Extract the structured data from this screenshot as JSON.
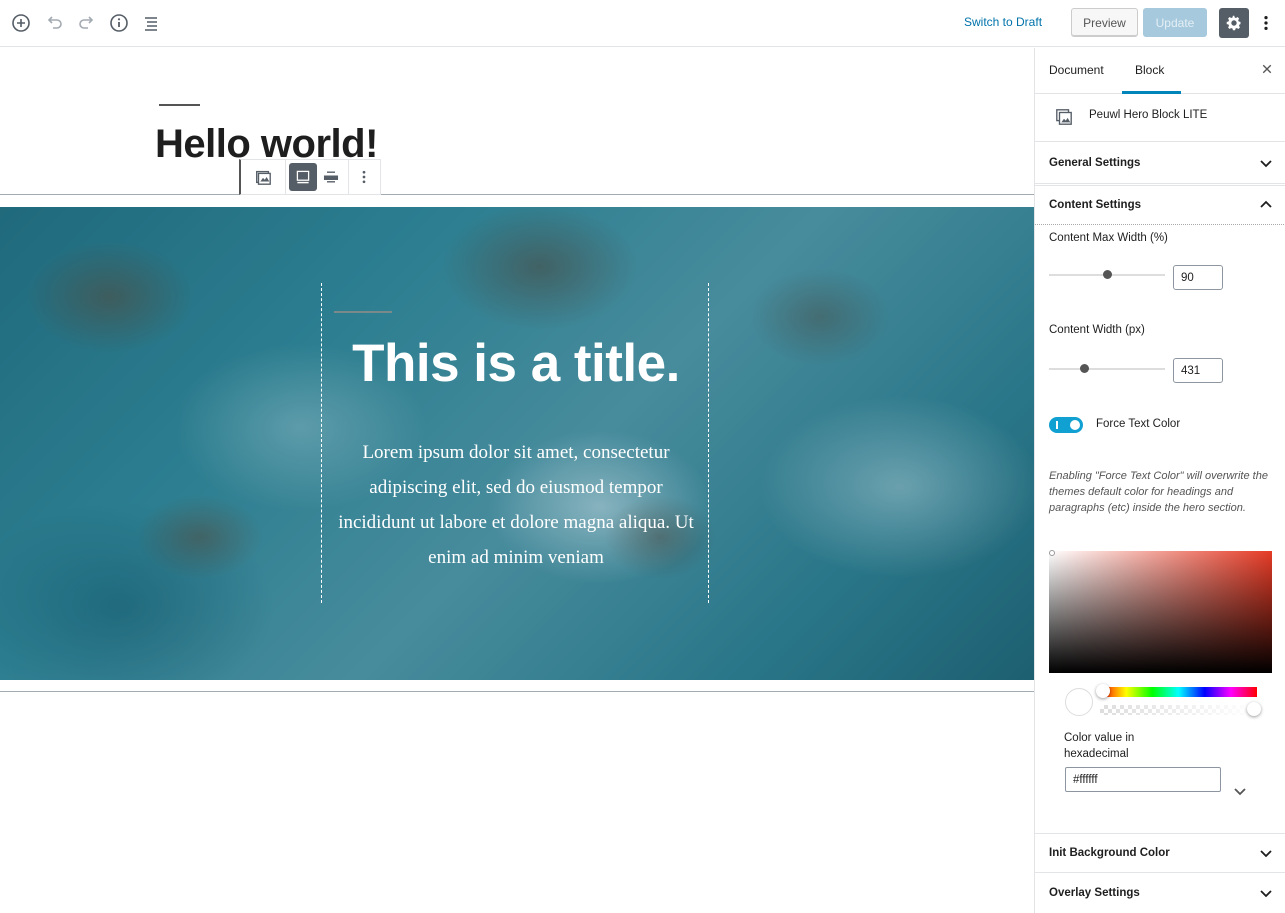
{
  "toolbar": {
    "switch_to_draft": "Switch to Draft",
    "preview": "Preview",
    "update": "Update"
  },
  "editor": {
    "post_title": "Hello world!",
    "hero": {
      "title": "This is a title.",
      "text": "Lorem ipsum dolor sit amet, consectetur adipiscing elit, sed do eiusmod tempor incididunt ut labore et dolore magna aliqua. Ut enim ad minim veniam"
    }
  },
  "sidebar": {
    "tabs": [
      {
        "label": "Document",
        "active": false
      },
      {
        "label": "Block",
        "active": true
      }
    ],
    "block_name": "Peuwl Hero Block LITE",
    "panels": {
      "general": "General Settings",
      "content": "Content Settings",
      "init_bg": "Init Background Color",
      "overlay": "Overlay Settings"
    },
    "content": {
      "max_width_label": "Content Max Width (%)",
      "max_width_value": "90",
      "max_width_level": 0.5,
      "width_label": "Content Width (px)",
      "width_value": "431",
      "width_level": 0.3,
      "force_text_color_label": "Force Text Color",
      "force_text_color_on": true,
      "help_text": "Enabling \"Force Text Color\" will overwrite the themes default color for headings and paragraphs (etc) inside the hero section.",
      "hex_label": "Color value in hexadecimal",
      "hex_value": "#ffffff"
    }
  },
  "colors": {
    "accent": "#0085ba",
    "toggle": "#11a0d2",
    "update_disabled": "#a6c9dd",
    "settings_active": "#555d66"
  }
}
